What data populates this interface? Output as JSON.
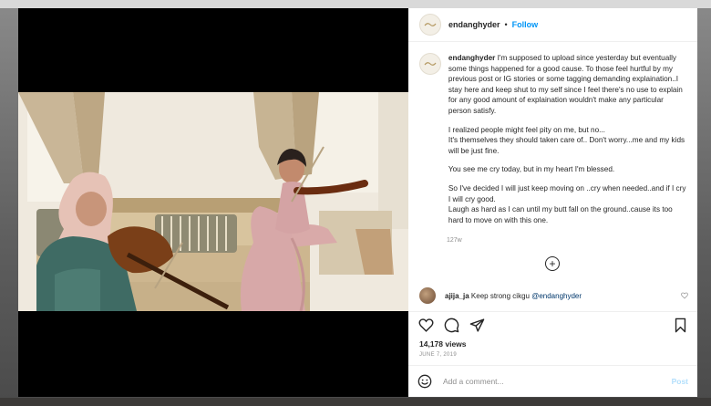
{
  "colors": {
    "link": "#0095f6",
    "text": "#262626",
    "muted": "#8e8e8e",
    "post_disabled": "#b2dffc"
  },
  "header": {
    "username": "endanghyder",
    "separator": "•",
    "follow": "Follow"
  },
  "caption": {
    "username": "endanghyder",
    "paragraphs": [
      "I'm supposed to upload since yesterday but eventually some things happened for a good cause. To those feel hurtful by my previous post or IG stories or some tagging demanding explaination..I stay here and keep shut to my self since I feel there's no use to explain for any good amount of explaination wouldn't make any particular person satisfy.",
      "I realized people might feel pity on me, but no...\nIt's themselves they should taken care of.. Don't worry...me and my kids will be just fine.",
      "You see me cry today, but in my heart I'm blessed.",
      "So I've decided I will just keep moving on ..cry when needed..and if I cry I will cry good.\nLaugh as hard as I can until my butt fall on the ground..cause its too hard to move on with this one."
    ],
    "age": "127w"
  },
  "more_comments_symbol": "+",
  "comment": {
    "username": "ajija_ja",
    "text": "Keep strong cikgu",
    "mention": "@endanghyder"
  },
  "icons": [
    "heart-icon",
    "comment-icon",
    "share-icon",
    "bookmark-icon",
    "emoji-icon",
    "volume-icon",
    "plus-circle-icon"
  ],
  "views": "14,178 views",
  "date": "JUNE 7, 2019",
  "add_comment": {
    "placeholder": "Add a comment...",
    "post": "Post"
  }
}
